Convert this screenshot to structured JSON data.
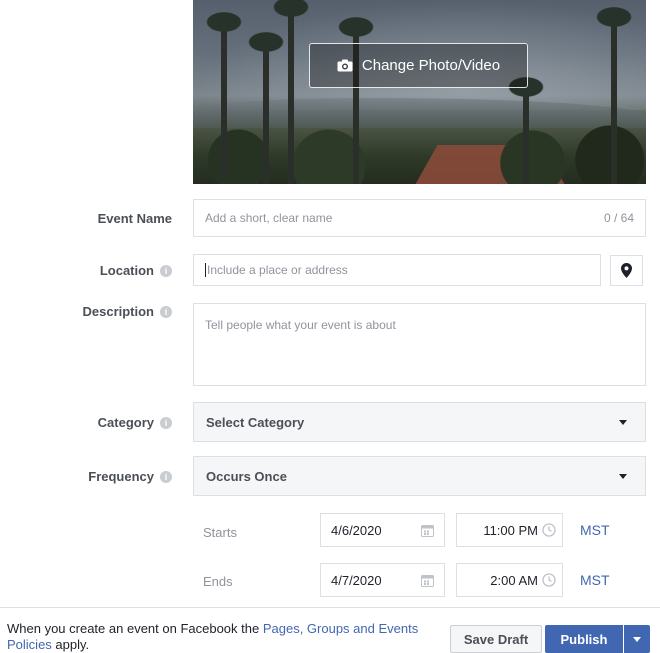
{
  "cover": {
    "change_label": "Change Photo/Video",
    "icon": "camera-icon"
  },
  "form": {
    "event_name": {
      "label": "Event Name",
      "placeholder": "Add a short, clear name",
      "counter": "0 / 64"
    },
    "location": {
      "label": "Location",
      "placeholder": "Include a place or address",
      "pin_icon": "map-pin-icon"
    },
    "description": {
      "label": "Description",
      "placeholder": "Tell people what your event is about"
    },
    "category": {
      "label": "Category",
      "value": "Select Category"
    },
    "frequency": {
      "label": "Frequency",
      "value": "Occurs Once"
    },
    "starts": {
      "label": "Starts",
      "date": "4/6/2020",
      "time": "11:00 PM",
      "tz": "MST"
    },
    "ends": {
      "label": "Ends",
      "date": "4/7/2020",
      "time": "2:00 AM",
      "tz": "MST"
    }
  },
  "footer": {
    "text_prefix": "When you create an event on Facebook the ",
    "link_text": "Pages, Groups and Events Policies",
    "text_suffix": " apply.",
    "save_label": "Save Draft",
    "publish_label": "Publish"
  },
  "colors": {
    "accent": "#4267b2",
    "border": "#dddfe2",
    "label": "#4b4f56"
  }
}
